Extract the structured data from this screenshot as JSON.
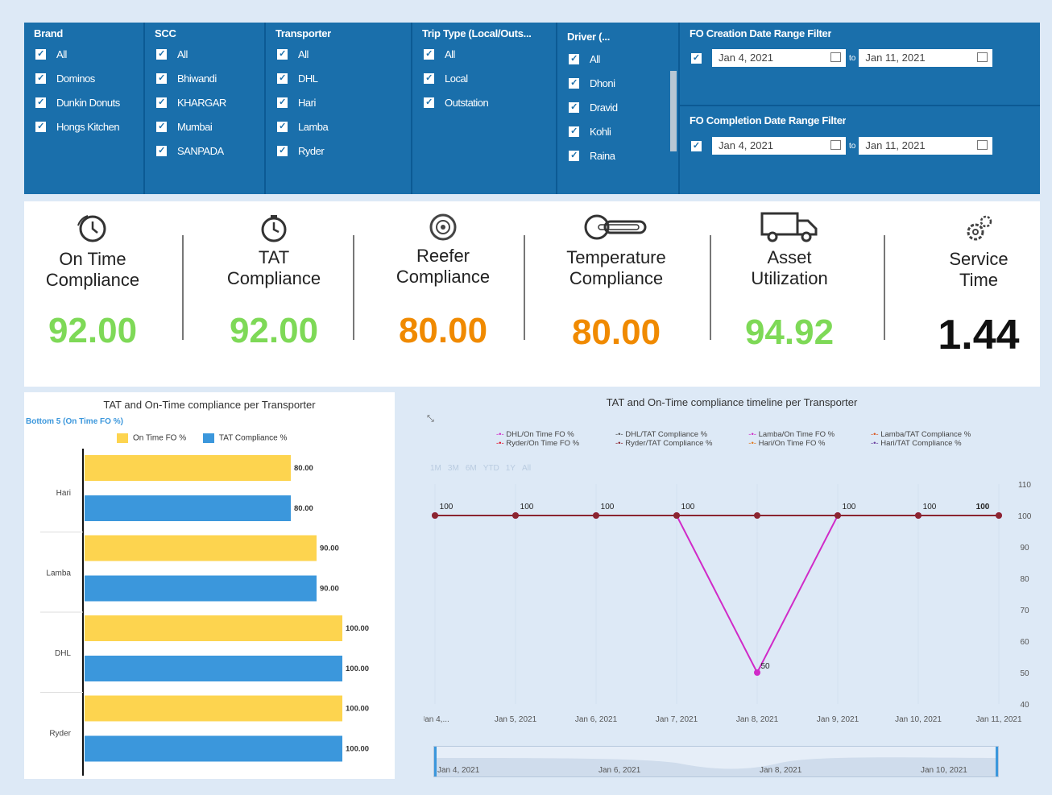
{
  "filters": {
    "brand": {
      "title": "Brand",
      "items": [
        "All",
        "Dominos",
        "Dunkin Donuts",
        "Hongs Kitchen"
      ]
    },
    "scc": {
      "title": "SCC",
      "items": [
        "All",
        "Bhiwandi",
        "KHARGAR",
        "Mumbai",
        "SANPADA"
      ]
    },
    "transporter": {
      "title": "Transporter",
      "items": [
        "All",
        "DHL",
        "Hari",
        "Lamba",
        "Ryder"
      ]
    },
    "trip_type": {
      "title": "Trip Type (Local/Outs...",
      "items": [
        "All",
        "Local",
        "Outstation"
      ]
    },
    "driver": {
      "title": "Driver (...",
      "items": [
        "All",
        "Dhoni",
        "Dravid",
        "Kohli",
        "Raina"
      ]
    },
    "fo_creation": {
      "title": "FO Creation Date Range Filter",
      "from": "Jan 4, 2021",
      "to_label": "to",
      "to": "Jan 11, 2021"
    },
    "fo_completion": {
      "title": "FO Completion Date Range Filter",
      "from": "Jan 4, 2021",
      "to_label": "to",
      "to": "Jan 11, 2021"
    },
    "check": "✓"
  },
  "kpis": [
    {
      "label1": "On Time",
      "label2": "Compliance",
      "value": "92.00",
      "color": "#7ed957",
      "icon": "clock-icon"
    },
    {
      "label1": "TAT",
      "label2": "Compliance",
      "value": "92.00",
      "color": "#7ed957",
      "icon": "timer-icon"
    },
    {
      "label1": "Reefer",
      "label2": "Compliance",
      "value": "80.00",
      "color": "#f08a00",
      "icon": "reefer-icon"
    },
    {
      "label1": "Temperature",
      "label2": "Compliance",
      "value": "80.00",
      "color": "#f08a00",
      "icon": "thermometer-icon"
    },
    {
      "label1": "Asset",
      "label2": "Utilization",
      "value": "94.92",
      "color": "#7ed957",
      "icon": "truck-icon"
    },
    {
      "label1": "Service",
      "label2": "Time",
      "value": "1.44",
      "color": "#111111",
      "icon": "gears-icon"
    }
  ],
  "bar_panel": {
    "title": "TAT and On-Time compliance per Transporter",
    "subtitle": "Bottom 5 (On Time FO %)",
    "legend": [
      "On Time FO %",
      "TAT Compliance %"
    ]
  },
  "line_panel": {
    "title": "TAT and On-Time compliance timeline per Transporter",
    "legend": [
      "DHL/On Time FO %",
      "DHL/TAT Compliance %",
      "Lamba/On Time FO %",
      "Lamba/TAT Compliance %",
      "Ryder/On Time FO %",
      "Ryder/TAT Compliance %",
      "Hari/On Time FO %",
      "Hari/TAT Compliance %"
    ],
    "range_buttons": [
      "1M",
      "3M",
      "6M",
      "YTD",
      "1Y",
      "All"
    ],
    "navigator_labels": [
      "Jan 4, 2021",
      "Jan 6, 2021",
      "Jan 8, 2021",
      "Jan 10, 2021"
    ]
  },
  "chart_data": [
    {
      "type": "bar",
      "title": "TAT and On-Time compliance per Transporter",
      "categories": [
        "Hari",
        "Lamba",
        "DHL",
        "Ryder"
      ],
      "series": [
        {
          "name": "On Time FO %",
          "values": [
            80,
            90,
            100,
            100
          ],
          "color": "#fdd44f"
        },
        {
          "name": "TAT Compliance %",
          "values": [
            80,
            90,
            100,
            100
          ],
          "color": "#3b97dc"
        }
      ],
      "xlim": [
        0,
        100
      ]
    },
    {
      "type": "line",
      "title": "TAT and On-Time compliance timeline per Transporter",
      "x": [
        "Jan 4,...",
        "Jan 5, 2021",
        "Jan 6, 2021",
        "Jan 7, 2021",
        "Jan 8, 2021",
        "Jan 9, 2021",
        "Jan 10, 2021",
        "Jan 11, 2021"
      ],
      "series": [
        {
          "name": "DHL/On Time FO %",
          "values": [
            100,
            100,
            100,
            100,
            50,
            100,
            100,
            100
          ],
          "color": "#d02bc8"
        },
        {
          "name": "Ryder/TAT Compliance %",
          "values": [
            100,
            100,
            100,
            100,
            100,
            100,
            100,
            100
          ],
          "color": "#8b2530"
        }
      ],
      "point_labels": [
        "100",
        "100",
        "100",
        "100",
        "50",
        "100",
        "100",
        "100"
      ],
      "ylim": [
        40,
        110
      ],
      "yticks": [
        110,
        100,
        90,
        80,
        70,
        60,
        50,
        40
      ]
    }
  ]
}
